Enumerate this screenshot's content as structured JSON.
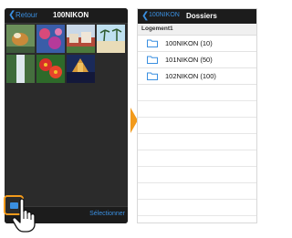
{
  "left_screen": {
    "back_label": "Retour",
    "title": "100NIKON",
    "select_label": "Sélectionner",
    "thumbnails": [
      {
        "name": "thumb-1"
      },
      {
        "name": "thumb-2"
      },
      {
        "name": "thumb-3"
      },
      {
        "name": "thumb-4"
      },
      {
        "name": "thumb-5"
      },
      {
        "name": "thumb-6"
      },
      {
        "name": "thumb-7"
      }
    ]
  },
  "right_screen": {
    "back_label": "100NIKON",
    "title": "Dossiers",
    "section_header": "Logement1",
    "folders": [
      {
        "label": "100NIKON (10)"
      },
      {
        "label": "101NIKON (50)"
      },
      {
        "label": "102NIKON (100)"
      }
    ]
  },
  "colors": {
    "accent": "#3a8fe0",
    "highlight": "#f29a1b",
    "dark_bg": "#2b2b2b"
  }
}
